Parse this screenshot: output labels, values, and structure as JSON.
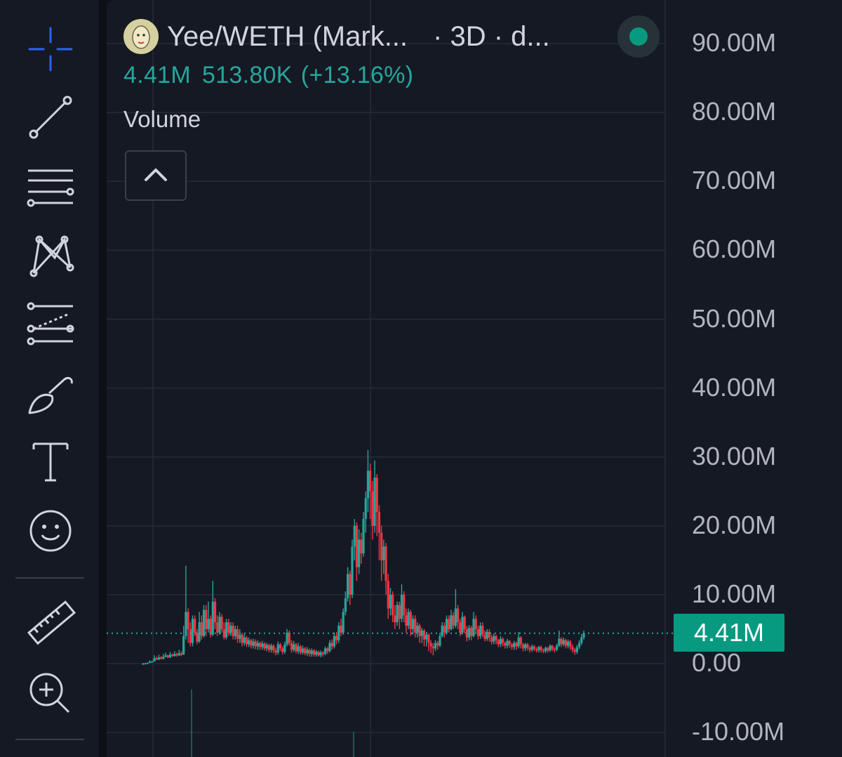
{
  "legend": {
    "symbol_title": "Yee/WETH (Mark...",
    "symbol_meta": "· 3D · d...",
    "value": "4.41M",
    "change": "513.80K",
    "change_pct": "(+13.16%)",
    "indicator": "Volume",
    "status_color": "#089981"
  },
  "toolbar": {
    "items": [
      "crosshair-icon",
      "trend-line-icon",
      "horizontal-lines-icon",
      "pattern-icon",
      "forecast-icon",
      "brush-icon",
      "text-icon",
      "emoji-icon",
      "ruler-icon",
      "zoom-in-icon"
    ]
  },
  "axis": {
    "labels": [
      "90.00M",
      "80.00M",
      "70.00M",
      "60.00M",
      "50.00M",
      "40.00M",
      "30.00M",
      "20.00M",
      "10.00M",
      "0.00",
      "-10.00M"
    ]
  },
  "price_tag": "4.41M",
  "colors": {
    "up": "#26a69a",
    "down": "#f23645",
    "tag": "#089981"
  },
  "chart_data": {
    "type": "candlestick",
    "ylim": [
      -11,
      95
    ],
    "last_value": 4.41,
    "grid": true,
    "candles": [
      [
        0.0,
        0.0,
        0.1,
        0.0
      ],
      [
        0.0,
        0.05,
        0.1,
        0.0
      ],
      [
        0.05,
        0.1,
        0.2,
        0.0
      ],
      [
        0.1,
        0.3,
        0.5,
        0.1
      ],
      [
        0.3,
        0.3,
        0.4,
        0.2
      ],
      [
        0.3,
        0.8,
        1.2,
        0.3
      ],
      [
        0.8,
        0.6,
        1.0,
        0.5
      ],
      [
        0.6,
        0.9,
        1.3,
        0.5
      ],
      [
        0.9,
        0.7,
        1.1,
        0.6
      ],
      [
        0.7,
        1.0,
        1.4,
        0.6
      ],
      [
        1.0,
        1.2,
        1.6,
        0.9
      ],
      [
        1.2,
        0.9,
        1.3,
        0.8
      ],
      [
        0.9,
        1.3,
        1.7,
        0.8
      ],
      [
        1.3,
        1.1,
        1.5,
        1.0
      ],
      [
        1.1,
        1.4,
        1.8,
        1.0
      ],
      [
        1.4,
        1.2,
        1.6,
        1.0
      ],
      [
        1.2,
        1.5,
        2.0,
        1.1
      ],
      [
        1.5,
        1.3,
        1.8,
        1.1
      ],
      [
        1.3,
        4.0,
        5.5,
        1.3
      ],
      [
        4.0,
        7.5,
        14.2,
        3.5
      ],
      [
        7.5,
        5.0,
        8.0,
        3.0
      ],
      [
        5.0,
        3.0,
        6.0,
        2.5
      ],
      [
        3.0,
        6.5,
        7.0,
        2.5
      ],
      [
        6.5,
        4.5,
        7.0,
        4.0
      ],
      [
        4.5,
        3.2,
        5.0,
        2.8
      ],
      [
        3.2,
        6.0,
        7.5,
        3.0
      ],
      [
        6.0,
        4.0,
        7.0,
        3.5
      ],
      [
        4.0,
        7.8,
        8.5,
        3.8
      ],
      [
        7.8,
        5.0,
        8.5,
        4.0
      ],
      [
        5.0,
        6.5,
        9.0,
        4.5
      ],
      [
        6.5,
        4.2,
        7.0,
        3.8
      ],
      [
        4.2,
        9.0,
        12.0,
        4.0
      ],
      [
        9.0,
        6.0,
        9.5,
        5.0
      ],
      [
        6.0,
        4.5,
        7.0,
        4.0
      ],
      [
        4.5,
        6.8,
        7.5,
        4.2
      ],
      [
        6.8,
        5.0,
        7.2,
        4.5
      ],
      [
        5.0,
        3.8,
        6.0,
        3.5
      ],
      [
        3.8,
        6.0,
        6.5,
        3.5
      ],
      [
        6.0,
        4.5,
        6.5,
        4.0
      ],
      [
        4.5,
        5.5,
        6.0,
        4.0
      ],
      [
        5.5,
        4.0,
        6.0,
        3.5
      ],
      [
        4.0,
        5.0,
        5.5,
        3.5
      ],
      [
        5.0,
        3.6,
        5.5,
        3.0
      ],
      [
        3.6,
        4.2,
        5.0,
        3.0
      ],
      [
        4.2,
        3.0,
        4.5,
        2.5
      ],
      [
        3.0,
        3.8,
        4.3,
        2.6
      ],
      [
        3.8,
        2.8,
        4.0,
        2.4
      ],
      [
        2.8,
        3.4,
        3.8,
        2.4
      ],
      [
        3.4,
        2.6,
        3.6,
        2.2
      ],
      [
        2.6,
        3.2,
        3.6,
        2.2
      ],
      [
        3.2,
        2.5,
        3.5,
        2.1
      ],
      [
        2.5,
        3.0,
        3.4,
        2.0
      ],
      [
        3.0,
        2.4,
        3.2,
        2.0
      ],
      [
        2.4,
        2.9,
        3.3,
        2.0
      ],
      [
        2.9,
        2.2,
        3.1,
        1.9
      ],
      [
        2.2,
        2.7,
        3.0,
        1.8
      ],
      [
        2.7,
        2.0,
        2.9,
        1.6
      ],
      [
        2.0,
        2.6,
        2.9,
        1.6
      ],
      [
        2.6,
        1.9,
        2.8,
        1.5
      ],
      [
        1.9,
        1.6,
        2.3,
        1.2
      ],
      [
        1.6,
        2.8,
        3.2,
        1.3
      ],
      [
        2.8,
        2.2,
        3.0,
        1.8
      ],
      [
        2.2,
        1.7,
        2.5,
        1.3
      ],
      [
        1.7,
        2.8,
        3.2,
        1.4
      ],
      [
        2.8,
        4.5,
        5.0,
        2.5
      ],
      [
        4.5,
        3.0,
        4.8,
        2.6
      ],
      [
        3.0,
        2.0,
        3.4,
        1.6
      ],
      [
        2.0,
        2.8,
        3.3,
        1.7
      ],
      [
        2.8,
        1.8,
        3.0,
        1.5
      ],
      [
        1.8,
        2.5,
        3.0,
        1.4
      ],
      [
        2.5,
        1.6,
        2.7,
        1.3
      ],
      [
        1.6,
        2.2,
        2.6,
        1.3
      ],
      [
        2.2,
        1.5,
        2.4,
        1.2
      ],
      [
        1.5,
        2.0,
        2.4,
        1.1
      ],
      [
        2.0,
        1.4,
        2.2,
        1.0
      ],
      [
        1.4,
        1.9,
        2.2,
        1.0
      ],
      [
        1.9,
        1.3,
        2.1,
        1.0
      ],
      [
        1.3,
        1.7,
        2.0,
        1.0
      ],
      [
        1.7,
        1.2,
        1.9,
        1.0
      ],
      [
        1.2,
        1.6,
        1.9,
        0.9
      ],
      [
        1.6,
        1.4,
        1.8,
        1.0
      ],
      [
        1.4,
        2.2,
        2.5,
        1.2
      ],
      [
        2.2,
        1.8,
        2.4,
        1.4
      ],
      [
        1.8,
        3.0,
        3.4,
        1.6
      ],
      [
        3.0,
        2.5,
        3.5,
        2.0
      ],
      [
        2.5,
        4.0,
        4.5,
        2.2
      ],
      [
        4.0,
        3.4,
        4.6,
        2.8
      ],
      [
        3.4,
        5.5,
        6.0,
        3.0
      ],
      [
        5.5,
        4.5,
        6.5,
        4.0
      ],
      [
        4.5,
        7.5,
        8.0,
        4.2
      ],
      [
        7.5,
        9.5,
        10.5,
        7.0
      ],
      [
        9.5,
        13.0,
        14.0,
        9.0
      ],
      [
        13.0,
        10.0,
        13.5,
        8.5
      ],
      [
        10.0,
        17.0,
        18.0,
        9.5
      ],
      [
        17.0,
        20.0,
        21.0,
        15.0
      ],
      [
        20.0,
        14.0,
        20.5,
        12.0
      ],
      [
        14.0,
        18.0,
        19.5,
        13.0
      ],
      [
        18.0,
        16.0,
        19.0,
        14.5
      ],
      [
        16.0,
        21.0,
        22.0,
        15.5
      ],
      [
        21.0,
        24.0,
        25.0,
        19.0
      ],
      [
        24.0,
        28.0,
        31.0,
        22.0
      ],
      [
        28.0,
        25.0,
        29.0,
        21.0
      ],
      [
        25.0,
        20.0,
        26.5,
        18.0
      ],
      [
        20.0,
        27.0,
        29.5,
        19.0
      ],
      [
        27.0,
        22.0,
        27.5,
        18.5
      ],
      [
        22.0,
        19.0,
        23.0,
        15.0
      ],
      [
        19.0,
        15.0,
        20.0,
        12.0
      ],
      [
        15.0,
        17.0,
        18.0,
        13.0
      ],
      [
        17.0,
        12.0,
        17.5,
        10.0
      ],
      [
        12.0,
        8.0,
        13.0,
        6.5
      ],
      [
        8.0,
        10.0,
        11.0,
        7.0
      ],
      [
        10.0,
        7.0,
        10.5,
        6.0
      ],
      [
        7.0,
        6.0,
        8.5,
        5.0
      ],
      [
        6.0,
        8.5,
        9.0,
        5.5
      ],
      [
        8.5,
        6.5,
        9.0,
        5.0
      ],
      [
        6.5,
        10.0,
        11.5,
        6.0
      ],
      [
        10.0,
        7.0,
        10.5,
        6.0
      ],
      [
        7.0,
        5.5,
        8.0,
        4.5
      ],
      [
        5.5,
        7.5,
        8.0,
        5.0
      ],
      [
        7.5,
        5.0,
        7.8,
        4.0
      ],
      [
        5.0,
        6.5,
        7.0,
        4.2
      ],
      [
        6.5,
        4.5,
        7.0,
        3.8
      ],
      [
        4.5,
        5.5,
        6.0,
        3.8
      ],
      [
        5.5,
        4.0,
        5.8,
        3.0
      ],
      [
        4.0,
        4.8,
        5.2,
        3.0
      ],
      [
        4.8,
        3.5,
        5.0,
        2.5
      ],
      [
        3.5,
        4.2,
        4.6,
        2.5
      ],
      [
        4.2,
        3.0,
        4.4,
        1.8
      ],
      [
        3.0,
        2.5,
        3.4,
        1.5
      ],
      [
        2.5,
        2.2,
        3.0,
        1.2
      ],
      [
        2.2,
        3.0,
        3.4,
        1.8
      ],
      [
        3.0,
        2.6,
        3.3,
        2.0
      ],
      [
        2.6,
        4.0,
        4.5,
        2.4
      ],
      [
        4.0,
        5.5,
        6.0,
        3.8
      ],
      [
        5.5,
        4.5,
        6.0,
        3.8
      ],
      [
        4.5,
        6.5,
        7.0,
        4.2
      ],
      [
        6.5,
        5.0,
        7.0,
        4.5
      ],
      [
        5.0,
        7.0,
        7.8,
        4.8
      ],
      [
        7.0,
        5.5,
        7.5,
        5.0
      ],
      [
        5.5,
        8.0,
        10.8,
        5.2
      ],
      [
        8.0,
        6.0,
        8.5,
        5.0
      ],
      [
        6.0,
        4.5,
        6.5,
        4.0
      ],
      [
        4.5,
        6.8,
        7.5,
        4.2
      ],
      [
        6.8,
        5.0,
        7.0,
        4.4
      ],
      [
        5.0,
        3.8,
        5.5,
        3.2
      ],
      [
        3.8,
        5.2,
        5.6,
        3.4
      ],
      [
        5.2,
        4.0,
        5.5,
        3.4
      ],
      [
        4.0,
        6.5,
        7.5,
        3.8
      ],
      [
        6.5,
        5.0,
        7.0,
        4.5
      ],
      [
        5.0,
        4.0,
        5.5,
        3.5
      ],
      [
        4.0,
        5.5,
        6.0,
        3.6
      ],
      [
        5.5,
        4.2,
        6.0,
        3.8
      ],
      [
        4.2,
        3.6,
        4.8,
        3.2
      ],
      [
        3.6,
        4.6,
        5.0,
        3.3
      ],
      [
        4.6,
        3.8,
        5.0,
        3.2
      ],
      [
        3.8,
        3.2,
        4.2,
        2.8
      ],
      [
        3.2,
        4.0,
        4.4,
        2.8
      ],
      [
        4.0,
        3.4,
        4.2,
        2.8
      ],
      [
        3.4,
        2.8,
        3.6,
        2.4
      ],
      [
        2.8,
        3.6,
        4.0,
        2.4
      ],
      [
        3.6,
        3.0,
        3.8,
        2.5
      ],
      [
        3.0,
        2.6,
        3.2,
        2.2
      ],
      [
        2.6,
        3.3,
        3.6,
        2.2
      ],
      [
        3.3,
        2.8,
        3.4,
        2.3
      ],
      [
        2.8,
        2.4,
        3.0,
        2.0
      ],
      [
        2.4,
        3.0,
        3.3,
        2.0
      ],
      [
        3.0,
        2.5,
        3.2,
        2.0
      ],
      [
        2.5,
        3.8,
        4.6,
        2.2
      ],
      [
        3.8,
        2.8,
        4.0,
        2.2
      ],
      [
        2.8,
        2.2,
        3.0,
        1.8
      ],
      [
        2.2,
        2.8,
        3.0,
        1.8
      ],
      [
        2.8,
        2.3,
        3.0,
        1.9
      ],
      [
        2.3,
        2.0,
        2.6,
        1.6
      ],
      [
        2.0,
        2.5,
        2.8,
        1.7
      ],
      [
        2.5,
        2.1,
        2.7,
        1.8
      ],
      [
        2.1,
        1.9,
        2.4,
        1.6
      ],
      [
        1.9,
        2.4,
        2.6,
        1.6
      ],
      [
        2.4,
        2.0,
        2.6,
        1.6
      ],
      [
        2.0,
        1.8,
        2.2,
        1.5
      ],
      [
        1.8,
        2.3,
        2.5,
        1.5
      ],
      [
        2.3,
        1.9,
        2.4,
        1.6
      ],
      [
        1.9,
        2.6,
        2.8,
        1.7
      ],
      [
        2.6,
        2.1,
        2.7,
        1.8
      ],
      [
        2.1,
        2.0,
        2.4,
        1.6
      ],
      [
        2.0,
        2.6,
        2.9,
        1.8
      ],
      [
        2.6,
        3.6,
        4.8,
        2.4
      ],
      [
        3.6,
        2.8,
        3.8,
        2.4
      ],
      [
        2.8,
        3.4,
        3.8,
        2.5
      ],
      [
        3.4,
        2.6,
        3.6,
        2.2
      ],
      [
        2.6,
        3.2,
        3.5,
        2.2
      ],
      [
        3.2,
        2.4,
        3.4,
        2.0
      ],
      [
        2.4,
        2.0,
        2.8,
        1.6
      ],
      [
        2.0,
        1.7,
        2.3,
        1.3
      ],
      [
        1.7,
        2.4,
        2.7,
        1.4
      ],
      [
        2.4,
        3.0,
        3.4,
        2.1
      ],
      [
        3.0,
        3.8,
        4.3,
        2.7
      ],
      [
        3.8,
        4.41,
        4.8,
        3.5
      ]
    ]
  }
}
